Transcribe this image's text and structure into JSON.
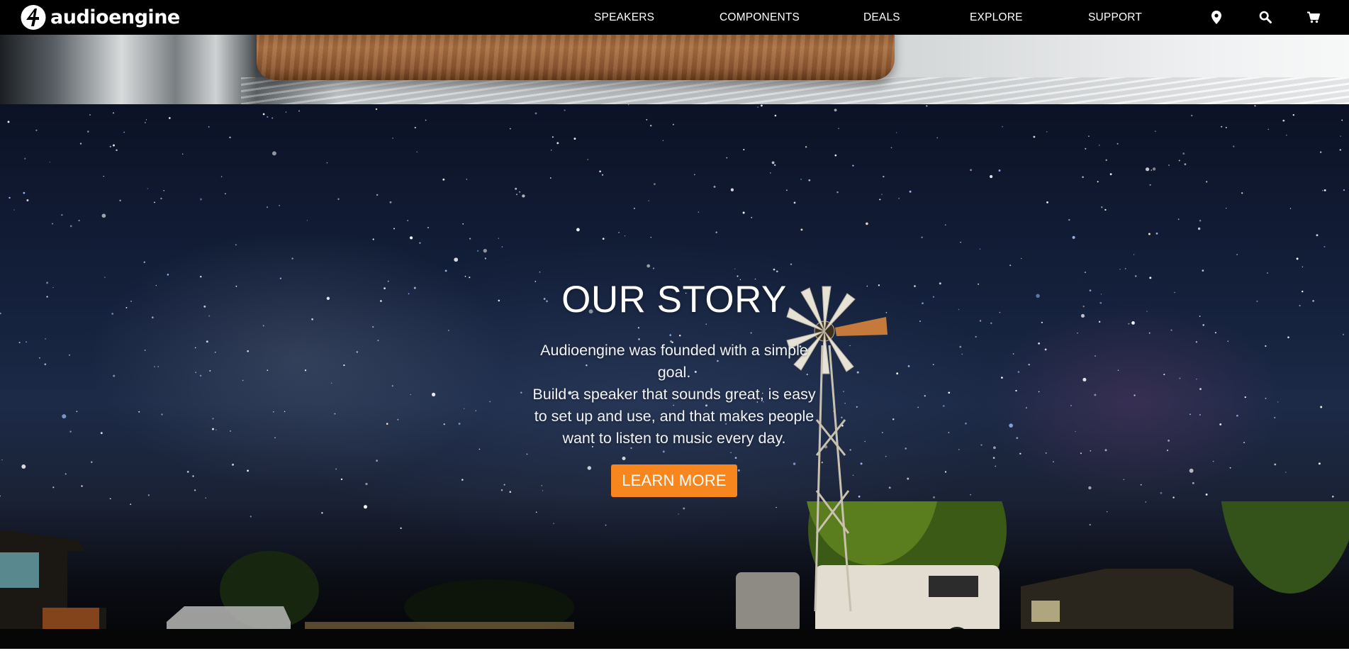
{
  "brand": {
    "name": "audioengine",
    "logo_icon": "audioengine-logo-mark",
    "accent_color": "#f7861e",
    "nav_background": "#000000"
  },
  "nav": {
    "items": [
      {
        "label": "SPEAKERS"
      },
      {
        "label": "COMPONENTS"
      },
      {
        "label": "DEALS"
      },
      {
        "label": "EXPLORE"
      },
      {
        "label": "SUPPORT"
      }
    ],
    "icons": [
      "location-pin-icon",
      "search-icon",
      "cart-icon"
    ]
  },
  "hero": {
    "title": "OUR STORY",
    "paragraph_lines": [
      "Audioengine was founded with a simple",
      "goal.",
      "Build a speaker that sounds great, is easy",
      "to set up and use, and that makes people",
      "want to listen to music every day."
    ],
    "cta_label": "LEARN MORE"
  }
}
